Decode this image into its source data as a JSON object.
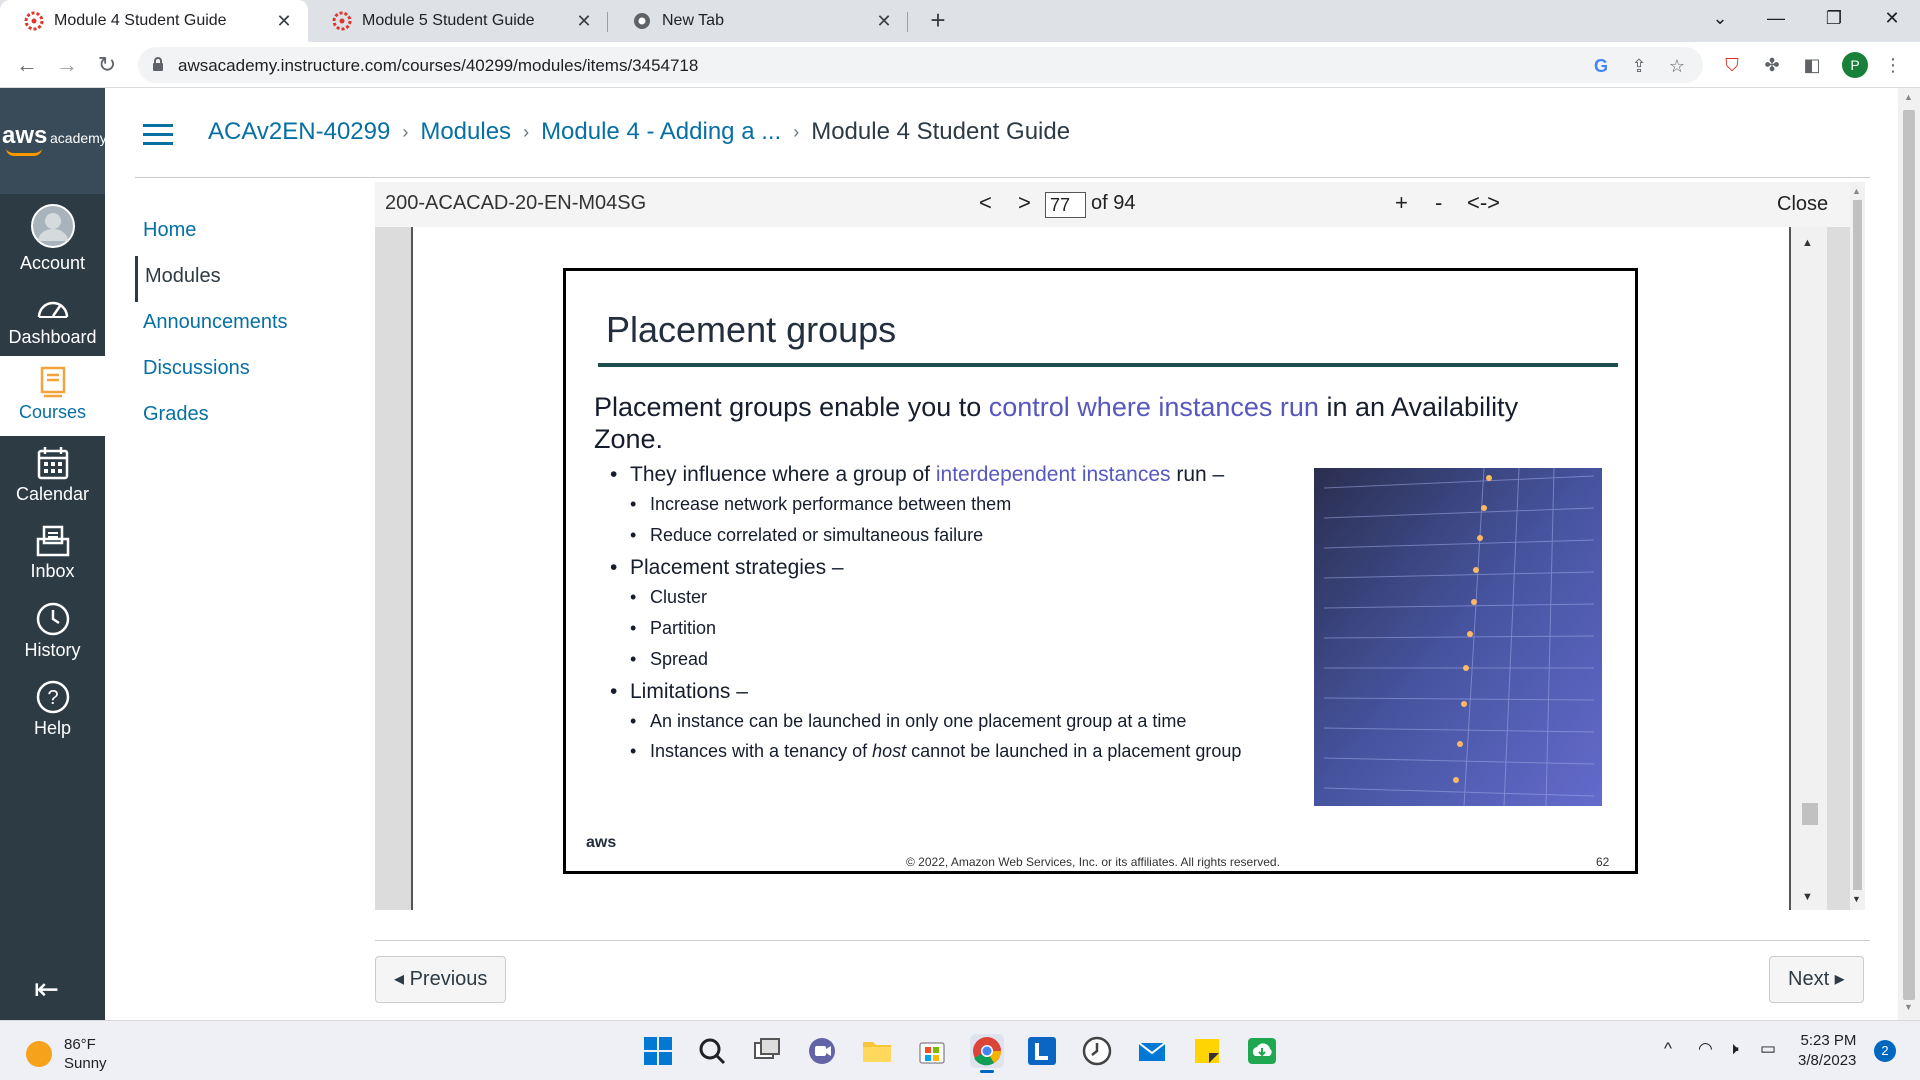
{
  "browser": {
    "tabs": [
      {
        "title": "Module 4 Student Guide",
        "active": true
      },
      {
        "title": "Module 5 Student Guide",
        "active": false
      },
      {
        "title": "New Tab",
        "active": false
      }
    ],
    "url": "awsacademy.instructure.com/courses/40299/modules/items/3454718",
    "profile_initial": "P"
  },
  "global_nav": {
    "logo_aws": "aws",
    "logo_academy": "academy",
    "items": [
      {
        "label": "Account",
        "icon": "avatar-icon"
      },
      {
        "label": "Dashboard",
        "icon": "dashboard-icon"
      },
      {
        "label": "Courses",
        "icon": "courses-icon"
      },
      {
        "label": "Calendar",
        "icon": "calendar-icon"
      },
      {
        "label": "Inbox",
        "icon": "inbox-icon"
      },
      {
        "label": "History",
        "icon": "history-icon"
      },
      {
        "label": "Help",
        "icon": "help-icon"
      }
    ]
  },
  "breadcrumb": {
    "course": "ACAv2EN-40299",
    "modules": "Modules",
    "module": "Module 4 - Adding a ...",
    "current": "Module 4 Student Guide"
  },
  "course_nav": [
    "Home",
    "Modules",
    "Announcements",
    "Discussions",
    "Grades"
  ],
  "viewer": {
    "doc_id": "200-ACACAD-20-EN-M04SG",
    "prev": "<",
    "next": ">",
    "page": "77",
    "page_of": "of 94",
    "zoom_in": "+",
    "zoom_out": "-",
    "fit": "<->",
    "close": "Close"
  },
  "slide": {
    "title": "Placement groups",
    "lead_pre": "Placement groups enable you to ",
    "lead_hl": "control where instances run",
    "lead_post": " in an Availability Zone.",
    "b1_pre": "They influence where a group of ",
    "b1_hl": "interdependent instances",
    "b1_post": " run –",
    "b1_sub": [
      "Increase network performance between them",
      "Reduce correlated or simultaneous failure"
    ],
    "b2": "Placement strategies –",
    "b2_sub": [
      "Cluster",
      "Partition",
      "Spread"
    ],
    "b3": "Limitations –",
    "b3_sub1": "An instance can be launched in only one placement group at a time",
    "b3_sub2_pre": "Instances with a tenancy of ",
    "b3_sub2_em": "host",
    "b3_sub2_post": " cannot be launched in a placement group",
    "footer_logo": "aws",
    "copyright": "© 2022, Amazon Web Services, Inc. or its affiliates. All rights reserved.",
    "slide_number": "62"
  },
  "pager": {
    "previous": "◂ Previous",
    "next": "Next ▸"
  },
  "taskbar": {
    "temp": "86°F",
    "condition": "Sunny",
    "time": "5:23 PM",
    "date": "3/8/2023",
    "notifications": "2"
  }
}
